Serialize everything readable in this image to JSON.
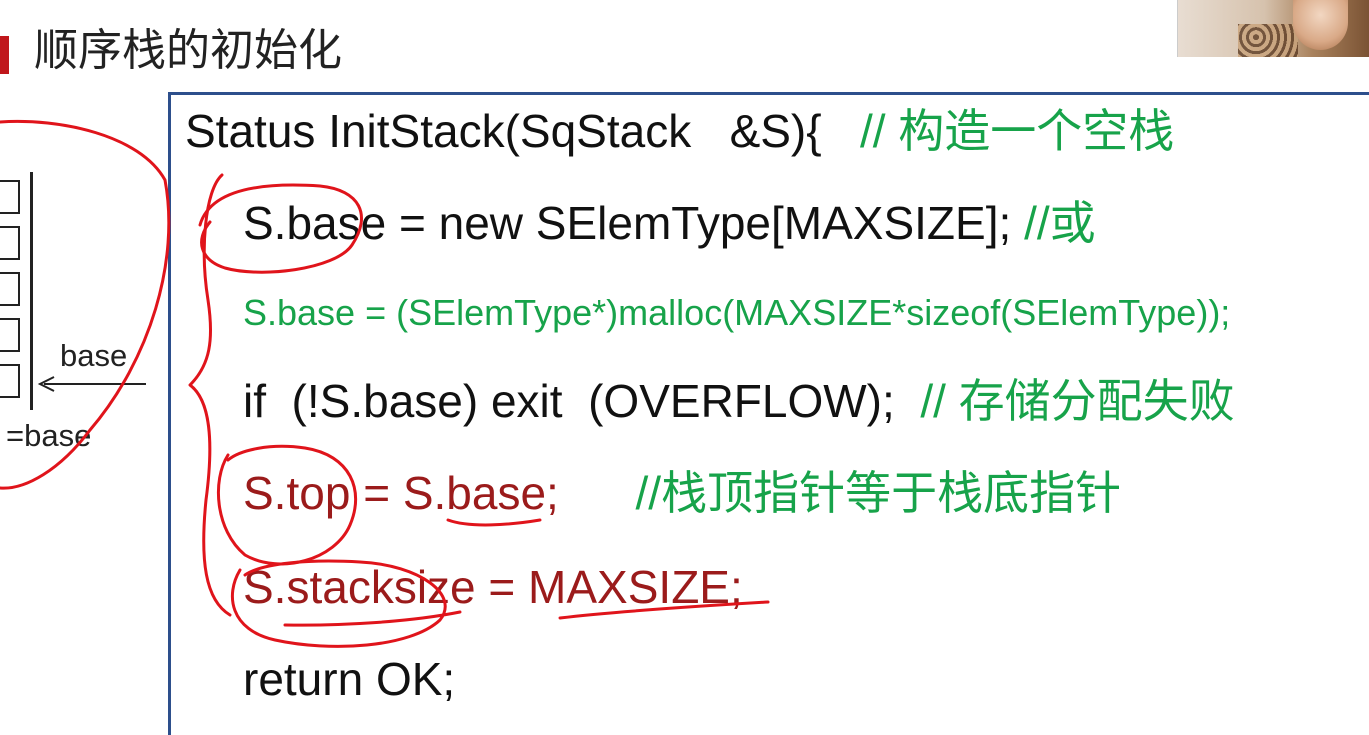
{
  "title": "顺序栈的初始化",
  "diagram": {
    "base_label": "base",
    "top_eq_label": "=base"
  },
  "code": {
    "line1_code": "Status InitStack(SqStack   &S){",
    "line1_comment": "// 构造一个空栈",
    "line2_code": "S.base = new SElemType[MAXSIZE];",
    "line2_comment": "//或",
    "line3": "S.base = (SElemType*)malloc(MAXSIZE*sizeof(SElemType));",
    "line4_code": "if  (!S.base) exit  (OVERFLOW);",
    "line4_comment": "// 存储分配失败",
    "line5_code": "S.top = S.base;",
    "line5_comment": "//栈顶指针等于栈底指针",
    "line6_code": "S.stacksize = MAXSIZE;",
    "line7_code": "return OK;"
  },
  "colors": {
    "accent": "#c0171c",
    "comment": "#17a34a",
    "annotation": "#e0141b",
    "frame": "#2d4f8c"
  }
}
